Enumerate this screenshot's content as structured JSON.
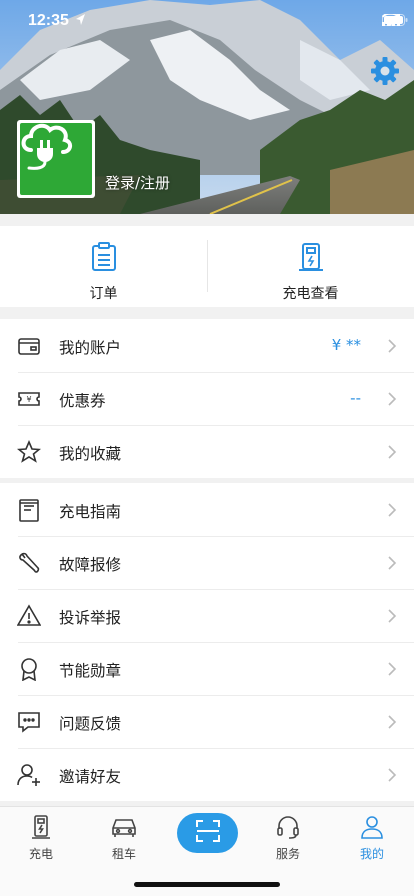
{
  "status": {
    "time": "12:35"
  },
  "profile": {
    "login_label": "登录/注册"
  },
  "quick_actions": [
    {
      "label": "订单",
      "icon": "clipboard-icon"
    },
    {
      "label": "充电查看",
      "icon": "charging-pile-icon"
    }
  ],
  "menu_group_1": [
    {
      "label": "我的账户",
      "value": "¥ **",
      "icon": "wallet-icon"
    },
    {
      "label": "优惠券",
      "value": "--",
      "icon": "coupon-icon"
    },
    {
      "label": "我的收藏",
      "value": "",
      "icon": "star-icon"
    }
  ],
  "menu_group_2": [
    {
      "label": "充电指南",
      "icon": "guide-book-icon"
    },
    {
      "label": "故障报修",
      "icon": "wrench-icon"
    },
    {
      "label": "投诉举报",
      "icon": "warning-icon"
    },
    {
      "label": "节能勋章",
      "icon": "medal-icon"
    },
    {
      "label": "问题反馈",
      "icon": "feedback-icon"
    },
    {
      "label": "邀请好友",
      "icon": "add-friend-icon"
    }
  ],
  "tabbar": [
    {
      "label": "充电",
      "icon": "charger-icon",
      "active": false
    },
    {
      "label": "租车",
      "icon": "car-icon",
      "active": false
    },
    {
      "label": "",
      "icon": "scan-icon",
      "active": false
    },
    {
      "label": "服务",
      "icon": "headset-icon",
      "active": false
    },
    {
      "label": "我的",
      "icon": "person-icon",
      "active": true
    }
  ],
  "colors": {
    "accent": "#2a8fe0",
    "brand_green": "#2ea836",
    "scan_button": "#2a9be6"
  }
}
